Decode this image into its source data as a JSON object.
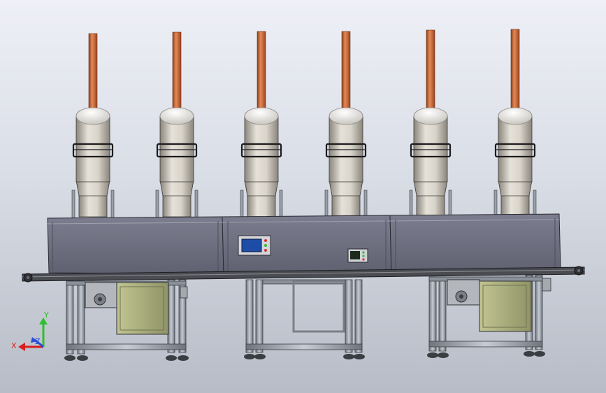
{
  "viewport": {
    "background_top": "#eef0f6",
    "background_bottom": "#b8bcc6"
  },
  "machine": {
    "station_count": 6,
    "colors": {
      "rod": "#c8683a",
      "canister_light": "#d9d4ca",
      "canister_dark": "#8a857c",
      "cabinet": "#6e6f80",
      "cabinet_dark": "#565767",
      "frame": "#9aa0a8",
      "electrical_box": "#a9ad7a",
      "belt": "#3a3a3a"
    },
    "hmi_panel": {
      "screen_color": "#1e4da8"
    },
    "controller_panel": {
      "display_color": "#1b2a1b"
    }
  },
  "triad": {
    "x_label": "X",
    "y_label": "Y",
    "z_label": "Z",
    "x_color": "#d81e1e",
    "y_color": "#2fbf2f",
    "z_color": "#2b4fd8"
  }
}
